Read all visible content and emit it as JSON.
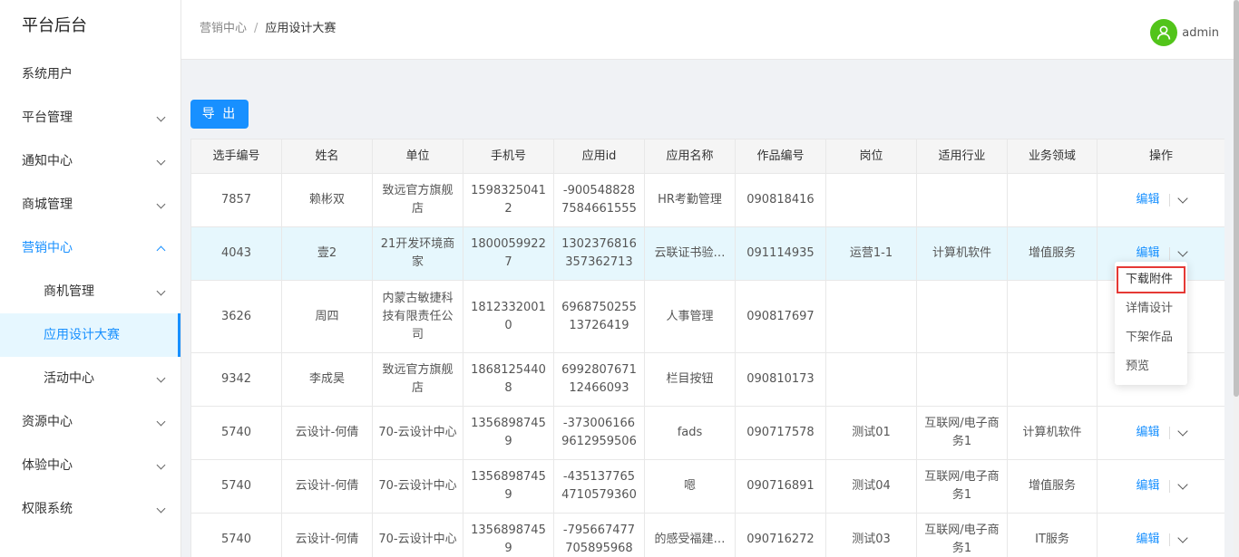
{
  "app": {
    "title": "平台后台"
  },
  "sidebar": {
    "items": [
      {
        "label": "系统用户"
      },
      {
        "label": "平台管理"
      },
      {
        "label": "通知中心"
      },
      {
        "label": "商城管理"
      },
      {
        "label": "营销中心"
      },
      {
        "label": "商机管理"
      },
      {
        "label": "应用设计大赛"
      },
      {
        "label": "活动中心"
      },
      {
        "label": "资源中心"
      },
      {
        "label": "体验中心"
      },
      {
        "label": "权限系统"
      }
    ]
  },
  "header": {
    "breadcrumb": [
      "营销中心",
      "/",
      "应用设计大赛"
    ],
    "user": "admin"
  },
  "toolbar": {
    "export_label": "导 出"
  },
  "table": {
    "columns": [
      "选手编号",
      "姓名",
      "单位",
      "手机号",
      "应用id",
      "应用名称",
      "作品编号",
      "岗位",
      "适用行业",
      "业务领域",
      "操作"
    ],
    "edit_label": "编辑",
    "rows": [
      [
        "7857",
        "赖彬双",
        "致远官方旗舰店",
        "15983250412",
        "-9005488287584661555",
        "HR考勤管理",
        "090818416",
        "",
        "",
        ""
      ],
      [
        "4043",
        "壹2",
        "21开发环境商家",
        "18000599227",
        "1302376816357362713",
        "云联证书验…",
        "091114935",
        "运营1-1",
        "计算机软件",
        "增值服务"
      ],
      [
        "3626",
        "周四",
        "内蒙古敏捷科技有限责任公司",
        "18123320010",
        "696875025513726419",
        "人事管理",
        "090817697",
        "",
        "",
        ""
      ],
      [
        "9342",
        "李成昊",
        "致远官方旗舰店",
        "18681254408",
        "699280767112466093",
        "栏目按钮",
        "090810173",
        "",
        "",
        ""
      ],
      [
        "5740",
        "云设计-何倩",
        "70-云设计中心",
        "13568987459",
        "-3730061669612959506",
        "fads",
        "090717578",
        "测试01",
        "互联网/电子商务1",
        "计算机软件"
      ],
      [
        "5740",
        "云设计-何倩",
        "70-云设计中心",
        "13568987459",
        "-4351377654710579360",
        "嗯",
        "090716891",
        "测试04",
        "互联网/电子商务1",
        "增值服务"
      ],
      [
        "5740",
        "云设计-何倩",
        "70-云设计中心",
        "13568987459",
        "-795667477705895968",
        "的感受福建…",
        "090716272",
        "测试03",
        "互联网/电子商务1",
        "IT服务"
      ]
    ]
  },
  "dropdown": {
    "items": [
      "下载附件",
      "详情设计",
      "下架作品",
      "预览"
    ]
  },
  "colors": {
    "accent": "#1890ff",
    "highlight_row": "#e6f7fd",
    "annotation_box": "#e53935",
    "avatar": "#52c41a"
  }
}
